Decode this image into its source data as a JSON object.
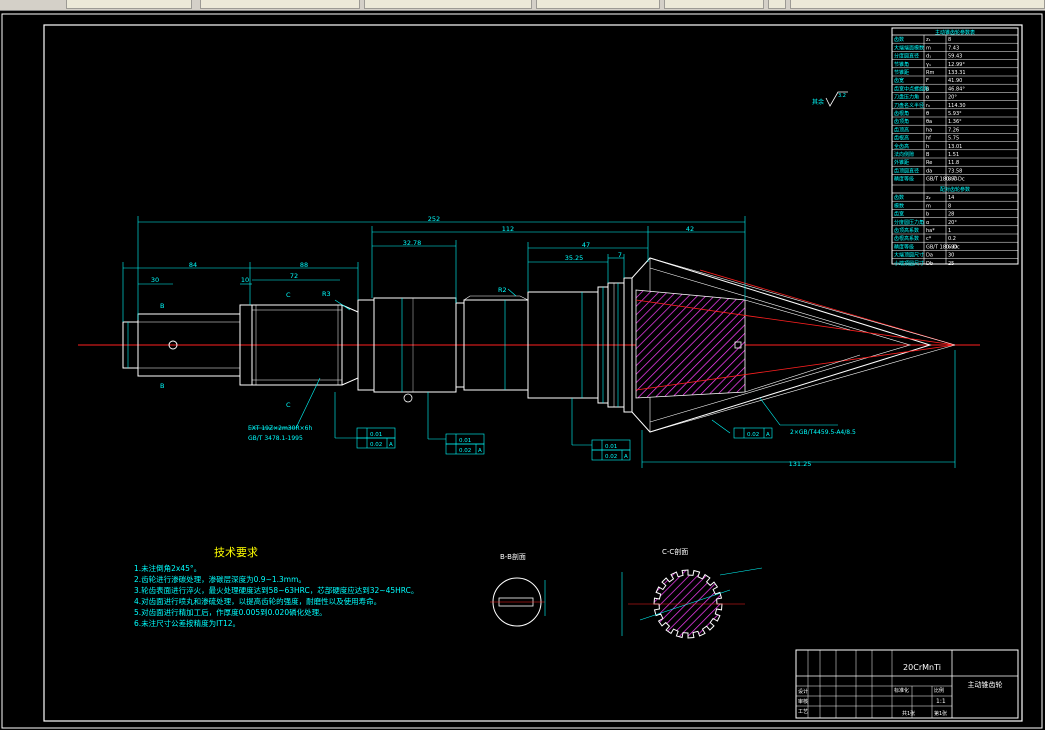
{
  "toolbar": {
    "tabs": [
      "",
      "",
      "",
      "",
      "",
      "",
      ""
    ]
  },
  "drawing": {
    "material": "20CrMnTi",
    "part_name": "主动锥齿轮",
    "section_bb": "B-B剖面",
    "section_cc": "C-C剖面",
    "roughness_note": "其余",
    "roughness_value": "3.2",
    "tech_req_title": "技术要求",
    "tech_req": [
      "1.未注倒角2x45°。",
      "2.齿轮进行渗碳处理，渗碳层深度为0.9~1.3mm。",
      "3.轮齿表面进行淬火，最火处理硬度达到58~63HRC，芯部硬度应达到32~45HRC。",
      "4.对齿面进行喷丸和渗硫处理，以提高齿轮的强度，耐磨性以及使用寿命。",
      "5.对齿面进行精加工后，作厚度0.005到0.020磷化处理。",
      "6.未注尺寸公差按精度为IT12。"
    ],
    "dimensions": {
      "overall": "252",
      "d112": "112",
      "d42": "42",
      "d84": "84",
      "d88": "88",
      "d72": "72",
      "d30": "30",
      "d10": "10",
      "d32_78": "32.78",
      "d47": "47",
      "d35_25": "35.25",
      "d7": "7",
      "d131_25": "131.25",
      "d28": "28",
      "r2": "R2",
      "r3": "R3",
      "phi_small": "Φ21",
      "spline_note_1": "EXT 19Z×2m30R×6h",
      "spline_note_2": "GB/T 3478.1-1995",
      "gear_note": "2×GB/T4459.5-A4/8.5",
      "tol_001": "0.01",
      "tol_002": "0.02",
      "datum_a": "A",
      "sec_b": "B",
      "sec_c": "C"
    },
    "param_header_1": "主动锥齿轮参数表",
    "param_header_2": "配对齿轮参数",
    "params_1": [
      [
        "齿数",
        "z₁",
        "8"
      ],
      [
        "大端端面模数",
        "m",
        "7.43"
      ],
      [
        "分度圆直径",
        "d₁",
        "59.43"
      ],
      [
        "节锥角",
        "γ₁",
        "12.99°"
      ],
      [
        "节锥距",
        "Rm",
        "133.31"
      ],
      [
        "齿宽",
        "F",
        "41.90"
      ],
      [
        "齿宽中点螺旋角",
        "β",
        "46.84°"
      ],
      [
        "刀盘压力角",
        "α",
        "20°"
      ],
      [
        "刀盘名义半径",
        "r₀",
        "114.30"
      ],
      [
        "齿根角",
        "θ",
        "5.93°"
      ],
      [
        "齿顶角",
        "θa",
        "1.36°"
      ],
      [
        "齿顶高",
        "ha",
        "7.26"
      ],
      [
        "齿根高",
        "hf",
        "5.75"
      ],
      [
        "全齿高",
        "h",
        "13.01"
      ],
      [
        "法向侧隙",
        "B",
        "1.51"
      ],
      [
        "外锥距",
        "Re",
        "11.8"
      ],
      [
        "齿顶圆直径",
        "da",
        "73.58"
      ],
      [
        "精度等级",
        "GB/T 180-90",
        "8-7-Dc"
      ]
    ],
    "params_2": [
      [
        "齿数",
        "z₂",
        "14"
      ],
      [
        "模数",
        "m",
        "8"
      ],
      [
        "齿宽",
        "b",
        "28"
      ],
      [
        "分度圆压力角",
        "α",
        "20°"
      ],
      [
        "齿顶高系数",
        "ha*",
        "1"
      ],
      [
        "齿根高系数",
        "c*",
        "0.2"
      ],
      [
        "精度等级",
        "GB/T 180-90",
        "6-Dc"
      ],
      [
        "大端顶圆尺寸",
        "Da",
        "30"
      ],
      [
        "小端顶圆尺寸",
        "Db",
        "25"
      ]
    ],
    "title_block": {
      "row_label_1": "设计",
      "row_label_2": "审核",
      "row_label_3": "工艺",
      "scale_label": "比例",
      "scale_value": "1:1",
      "sheet_label": "共1张",
      "sheet_no": "第1张",
      "std_label": "标准化"
    }
  }
}
